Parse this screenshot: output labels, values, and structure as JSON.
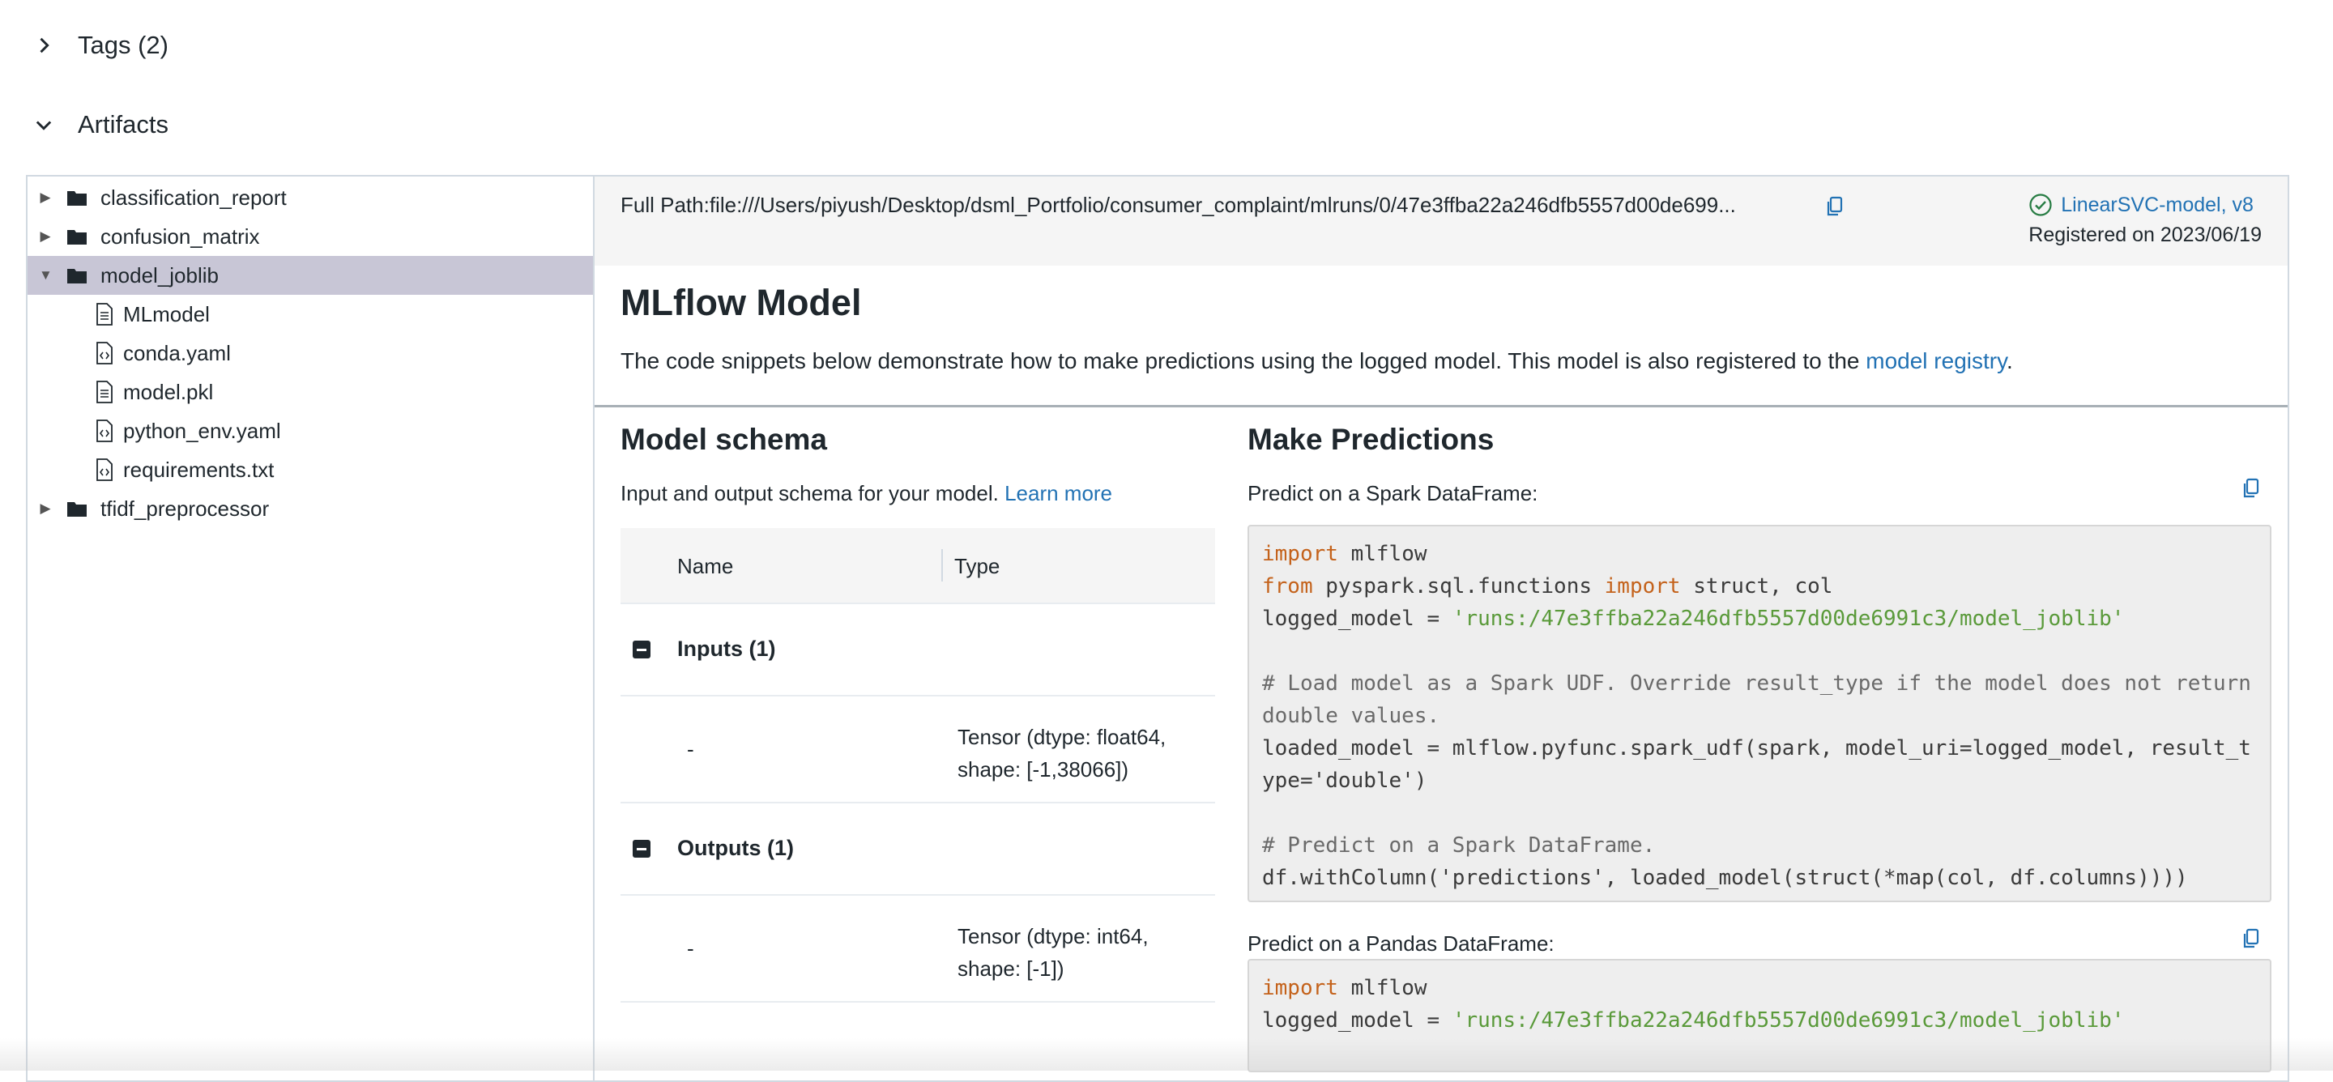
{
  "sections": {
    "tags_label": "Tags (2)",
    "artifacts_label": "Artifacts"
  },
  "tree": {
    "folders_top": [
      {
        "label": "classification_report"
      },
      {
        "label": "confusion_matrix"
      },
      {
        "label": "model_joblib"
      }
    ],
    "files": [
      {
        "label": "MLmodel",
        "icon": "text-file-icon"
      },
      {
        "label": "conda.yaml",
        "icon": "code-file-icon"
      },
      {
        "label": "model.pkl",
        "icon": "text-file-icon"
      },
      {
        "label": "python_env.yaml",
        "icon": "code-file-icon"
      },
      {
        "label": "requirements.txt",
        "icon": "code-file-icon"
      }
    ],
    "folder_bottom": {
      "label": "tfidf_preprocessor"
    }
  },
  "path_bar": {
    "full_path": "Full Path:file:///Users/piyush/Desktop/dsml_Portfolio/consumer_complaint/mlruns/0/47e3ffba22a246dfb5557d00de699...",
    "model_link": "LinearSVC-model, v8",
    "registered_on": "Registered on 2023/06/19"
  },
  "mlflow_model": {
    "title": "MLflow Model",
    "description": "The code snippets below demonstrate how to make predictions using the logged model. This model is also registered to the ",
    "registry_link": "model registry",
    "period": "."
  },
  "schema": {
    "title": "Model schema",
    "description": "Input and output schema for your model. ",
    "learn_more": "Learn more",
    "col_name": "Name",
    "col_type": "Type",
    "inputs_label": "Inputs (1)",
    "input_name": "-",
    "input_type_line1": "Tensor (dtype: float64,",
    "input_type_line2": "shape: [-1,38066])",
    "outputs_label": "Outputs (1)",
    "output_name": "-",
    "output_type_line1": "Tensor (dtype: int64,",
    "output_type_line2": "shape: [-1])"
  },
  "predictions": {
    "title": "Make Predictions",
    "spark_label": "Predict on a Spark DataFrame:",
    "pandas_label": "Predict on a Pandas DataFrame:",
    "spark_code": {
      "l1_kw": "import",
      "l1_rest": " mlflow",
      "l2_kw1": "from",
      "l2_mid": " pyspark.sql.functions ",
      "l2_kw2": "import",
      "l2_rest": " struct, col",
      "l3_pre": "logged_model = ",
      "l3_str": "'runs:/47e3ffba22a246dfb5557d00de6991c3/model_joblib'",
      "l5": "# Load model as a Spark UDF. Override result_type if the model does not return",
      "l6": "double values.",
      "l7": "loaded_model = mlflow.pyfunc.spark_udf(spark, model_uri=logged_model, result_t",
      "l8": "ype='double')",
      "l10": "# Predict on a Spark DataFrame.",
      "l11": "df.withColumn('predictions', loaded_model(struct(*map(col, df.columns))))"
    },
    "pandas_code": {
      "l1_kw": "import",
      "l1_rest": " mlflow",
      "l2_pre": "logged_model = ",
      "l2_str": "'runs:/47e3ffba22a246dfb5557d00de6991c3/model_joblib'"
    }
  }
}
